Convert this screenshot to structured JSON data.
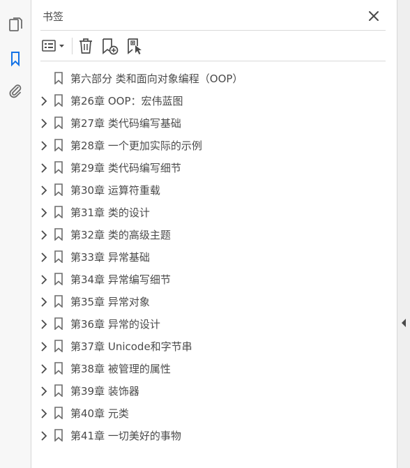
{
  "panel": {
    "title": "书签"
  },
  "rail": {
    "icons": [
      "pages-icon",
      "bookmark-icon",
      "attachment-icon"
    ]
  },
  "toolbar": {
    "buttons": [
      "options-menu-icon",
      "delete-bookmark-icon",
      "new-bookmark-icon",
      "new-bookmark-from-structure-icon"
    ]
  },
  "colors": {
    "icon": "#6b6b6b",
    "active_icon": "#1473e6",
    "text": "#4a4a4a"
  },
  "bookmarks": [
    {
      "label": "第六部分  类和面向对象编程（OOP）",
      "expandable": false
    },
    {
      "label": "第26章  OOP：宏伟蓝图",
      "expandable": true
    },
    {
      "label": "第27章  类代码编写基础",
      "expandable": true
    },
    {
      "label": "第28章  一个更加实际的示例",
      "expandable": true
    },
    {
      "label": "第29章  类代码编写细节",
      "expandable": true
    },
    {
      "label": "第30章  运算符重载",
      "expandable": true
    },
    {
      "label": "第31章  类的设计",
      "expandable": true
    },
    {
      "label": "第32章  类的高级主题",
      "expandable": true
    },
    {
      "label": "第33章  异常基础",
      "expandable": true
    },
    {
      "label": "第34章  异常编写细节",
      "expandable": true
    },
    {
      "label": "第35章  异常对象",
      "expandable": true
    },
    {
      "label": "第36章  异常的设计",
      "expandable": true
    },
    {
      "label": "第37章  Unicode和字节串",
      "expandable": true
    },
    {
      "label": "第38章  被管理的属性",
      "expandable": true
    },
    {
      "label": "第39章  装饰器",
      "expandable": true
    },
    {
      "label": "第40章  元类",
      "expandable": true
    },
    {
      "label": "第41章  一切美好的事物",
      "expandable": true
    }
  ]
}
